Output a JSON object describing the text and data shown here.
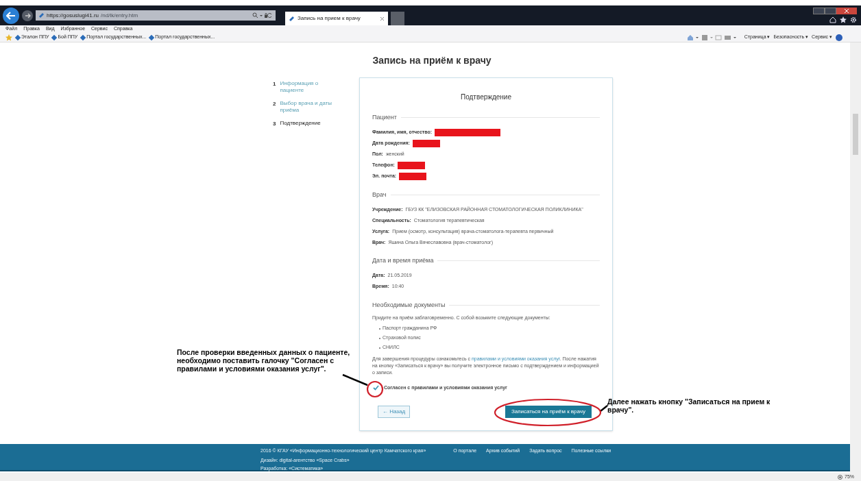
{
  "browser": {
    "url_host": "https://gosuslugi41.ru",
    "url_path": "/nd/lk/entry.htm",
    "tab_title": "Запись на прием к врачу",
    "menu": [
      "Файл",
      "Правка",
      "Вид",
      "Избранное",
      "Сервис",
      "Справка"
    ],
    "favorites": [
      "Эталон ППУ",
      "Бой ППУ",
      "Портал государственных...",
      "Портал государственных..."
    ],
    "commands": [
      "Страница ▾",
      "Безопасность ▾",
      "Сервис ▾"
    ],
    "zoom": "75%"
  },
  "page_title": "Запись на приём к врачу",
  "steps": [
    {
      "number": "1",
      "label": "Информация о пациенте",
      "selected": false
    },
    {
      "number": "2",
      "label": "Выбор врача и даты приёма",
      "selected": false
    },
    {
      "number": "3",
      "label": "Подтверждение",
      "selected": true
    }
  ],
  "card": {
    "title": "Подтверждение",
    "sections": [
      {
        "heading": "Пациент",
        "fields": [
          {
            "label": "Фамилия, имя, отчество:",
            "redacted": true
          },
          {
            "label": "Дата рождения:",
            "redacted": true
          },
          {
            "label": "Пол:",
            "value": "женский",
            "redacted": false
          },
          {
            "label": "Телефон:",
            "redacted": true
          },
          {
            "label": "Эл. почта:",
            "redacted": true
          }
        ]
      },
      {
        "heading": "Врач",
        "fields": [
          {
            "label": "Учреждение:",
            "value": "ГБУЗ КК \"ЕЛИЗОВСКАЯ РАЙОННАЯ СТОМАТОЛОГИЧЕСКАЯ ПОЛИКЛИНИКА\"",
            "redacted": false
          },
          {
            "label": "Специальность:",
            "value": "Стоматология терапевтическая",
            "redacted": false
          },
          {
            "label": "Услуга:",
            "value": "Прием (осмотр, консультация) врача-стоматолога-терапевта первичный",
            "redacted": false
          },
          {
            "label": "Врач:",
            "value": "Яшина Ольга Вячеславовна (врач-стоматолог)",
            "redacted": false
          }
        ]
      },
      {
        "heading": "Дата и время приёма",
        "fields": [
          {
            "label": "Дата:",
            "value": "21.05.2019",
            "redacted": false
          },
          {
            "label": "Время:",
            "value": "10:40",
            "redacted": false
          }
        ]
      }
    ],
    "documents": {
      "heading": "Необходимые документы",
      "intro": "Придите на приём заблаговременно. С собой возьмите следующие документы:",
      "items": [
        "Паспорт гражданина РФ",
        "Страховой полис",
        "СНИЛС"
      ],
      "note_before": "Для завершения процедуры ознакомьтесь с",
      "note_link": "правилами и условиями оказания услуг",
      "note_after": ". После нажатия на кнопку «Записаться к врачу» вы получите электронное письмо с подтверждением и информацией о записи."
    },
    "agreement": {
      "label": "Согласен с правилами и условиями оказания услуг",
      "checked": true
    },
    "back_button": "← Назад",
    "submit_button": "Записаться на приём к врачу"
  },
  "footer": {
    "copyright": "2016 © КГАУ «Информационно-технологический центр Камчатского края»",
    "design": "Дизайн: digital-агентство «Space Crabs»",
    "development": "Разработка: «Систематика»",
    "links": [
      "О портале",
      "Архив событий",
      "Задать вопрос",
      "Полезные ссылки"
    ]
  },
  "annotations": [
    "После проверки введенных данных о пациенте, необходимо поставить галочку \"Согласен с правилами и условиями оказания услуг\".",
    "Далее нажать кнопку \"Записаться на прием к врачу\"."
  ]
}
